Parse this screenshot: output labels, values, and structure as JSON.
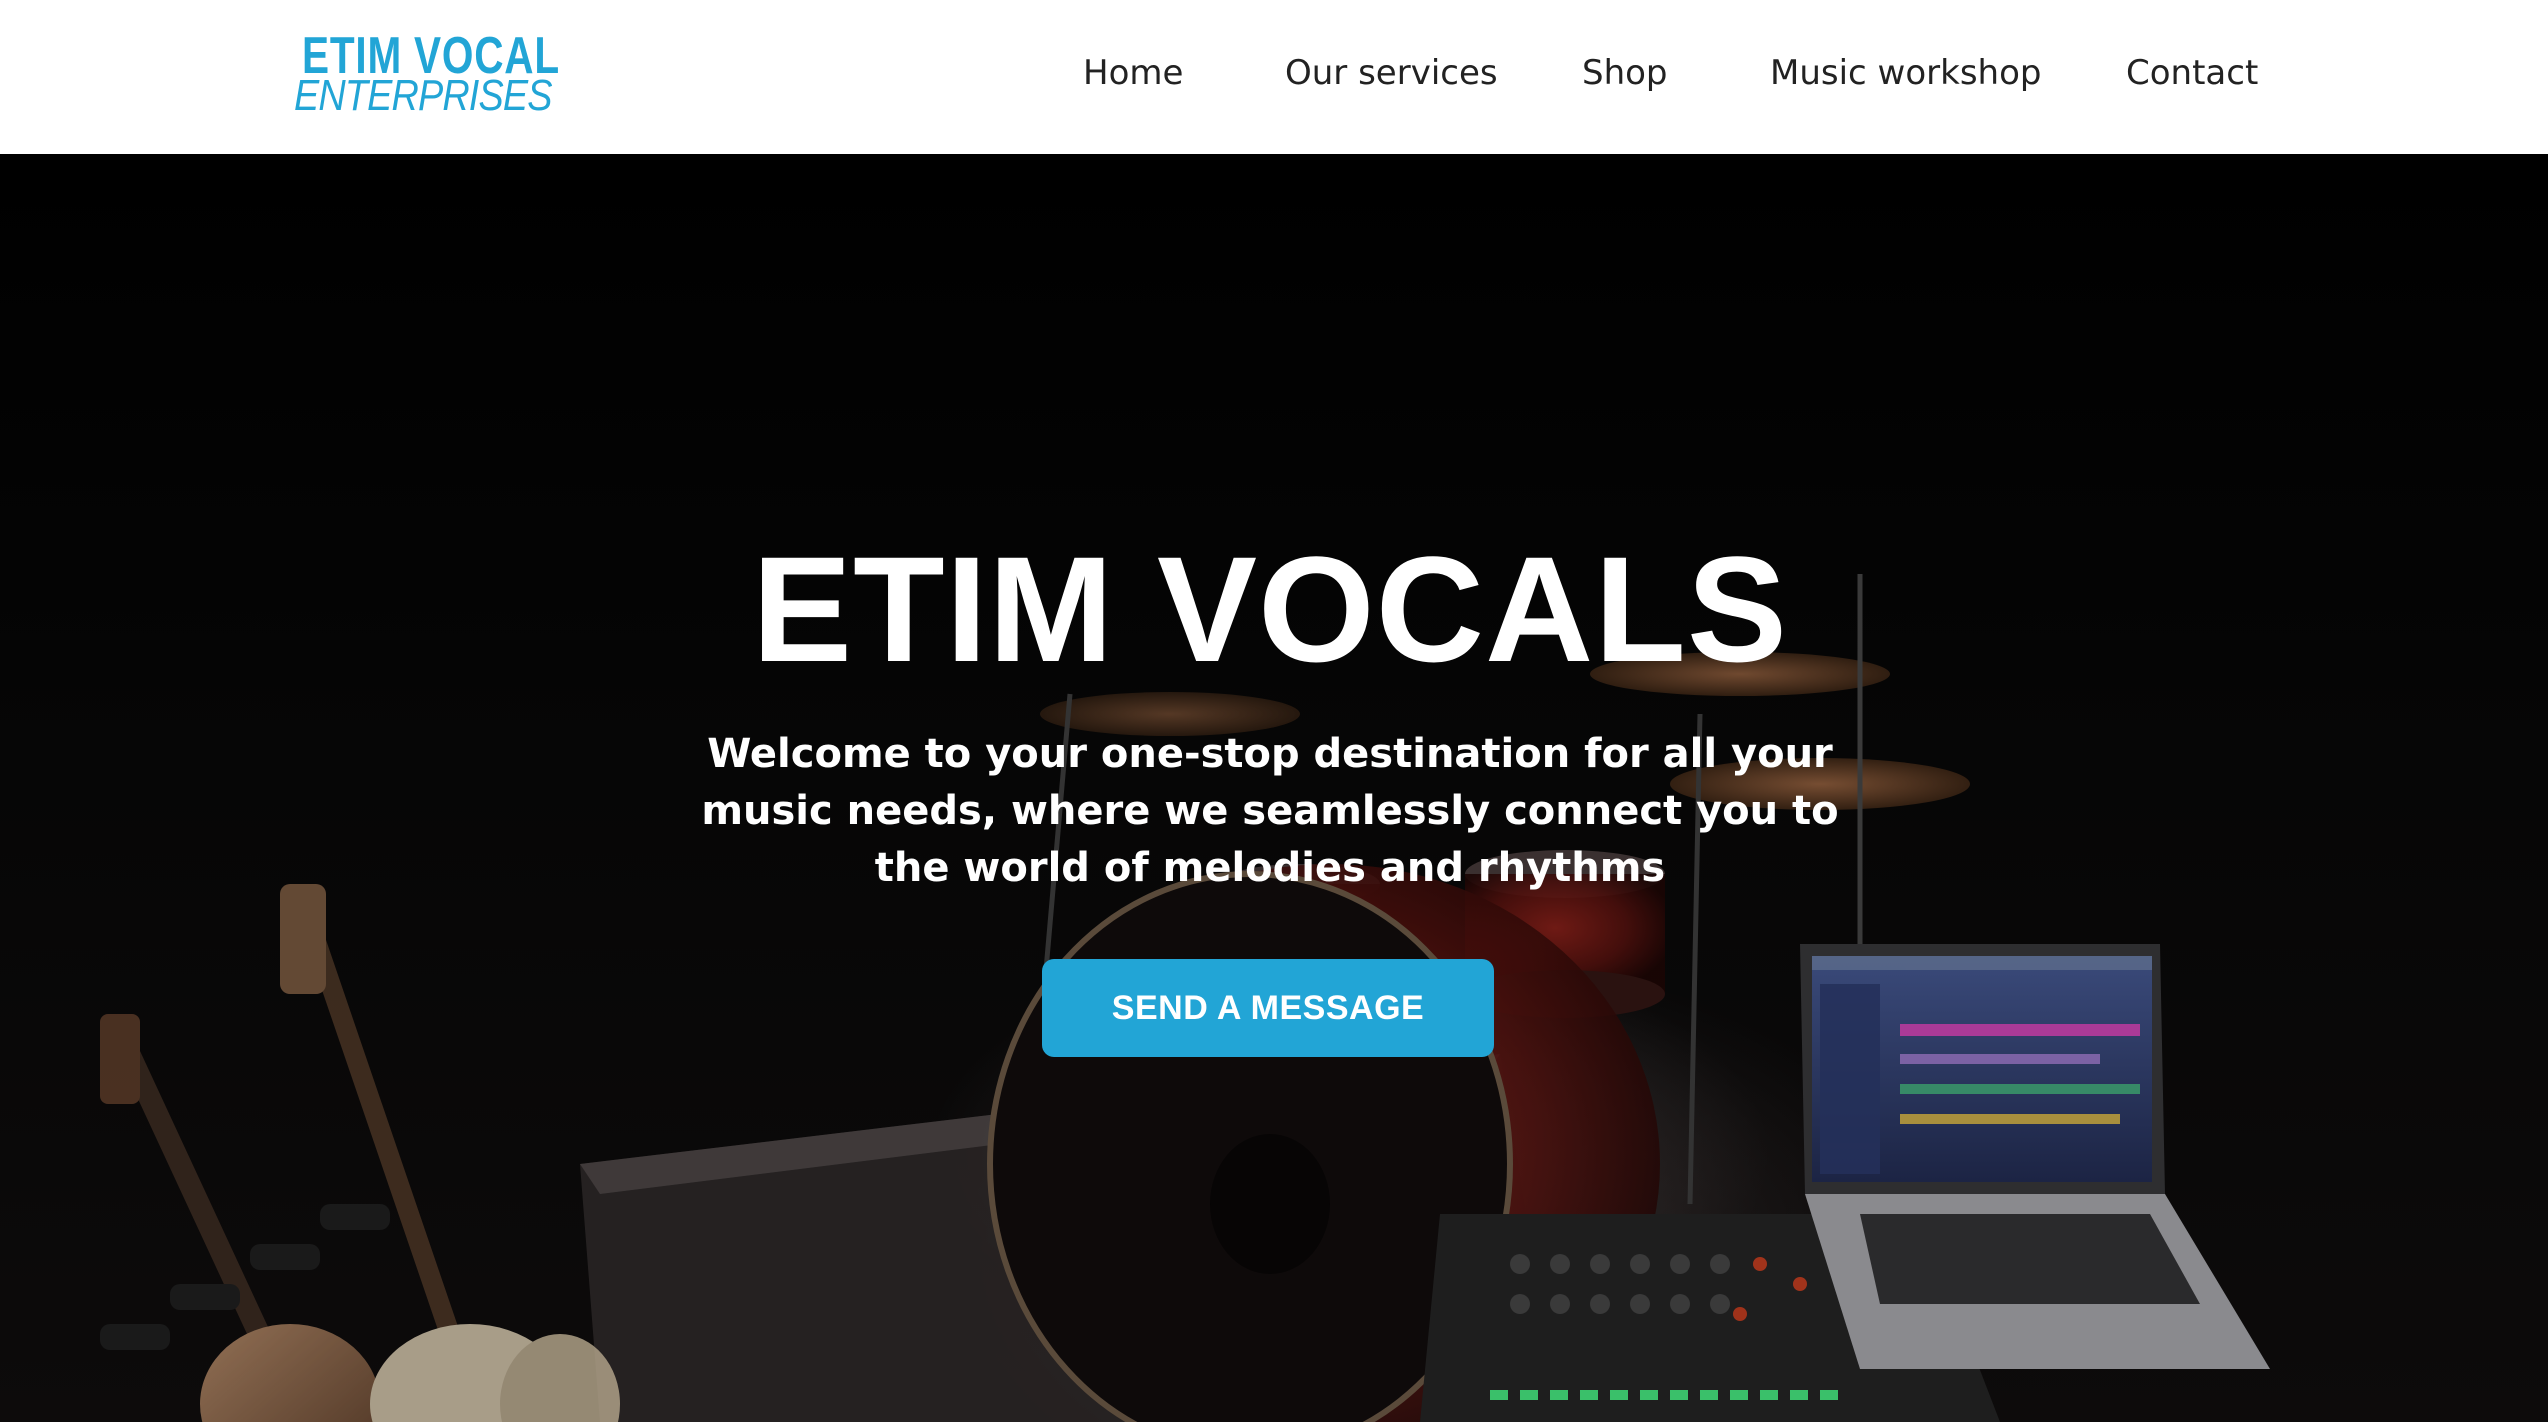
{
  "header": {
    "logo": {
      "line1": "ETIM VOCAL",
      "line2": "ENTERPRISES"
    },
    "nav": [
      {
        "label": "Home"
      },
      {
        "label": "Our services"
      },
      {
        "label": "Shop"
      },
      {
        "label": "Music workshop"
      },
      {
        "label": "Contact"
      }
    ]
  },
  "hero": {
    "title": "ETIM VOCALS",
    "subtitle": "Welcome to your one-stop destination for all your music needs, where we seamlessly connect you to the world of melodies and rhythms",
    "cta_label": "SEND A MESSAGE",
    "background_image": "music-studio-instruments-photo"
  },
  "colors": {
    "accent": "#22a5d6",
    "header_bg": "#ffffff",
    "hero_bg": "#000000",
    "nav_text": "#222222",
    "hero_text": "#ffffff"
  }
}
